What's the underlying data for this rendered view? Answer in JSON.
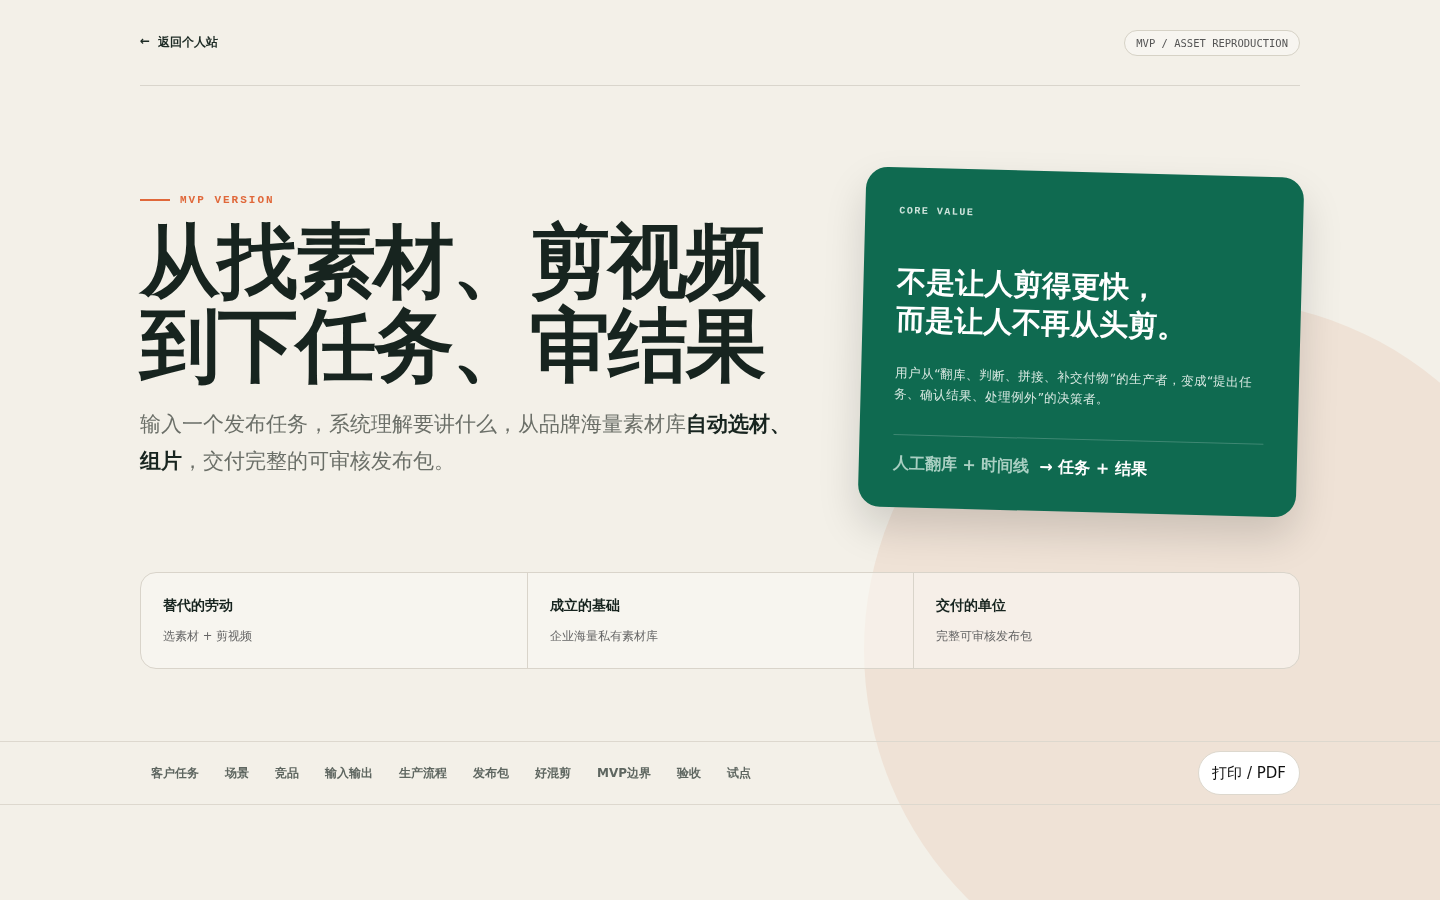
{
  "header": {
    "back_link": {
      "arrow": "←",
      "label": "返回个人站"
    },
    "badge": "MVP / ASSET REPRODUCTION"
  },
  "hero": {
    "eyebrow": "MVP VERSION",
    "title_lines": [
      "从找素材、剪视频",
      "到下任务、审结果"
    ],
    "subtitle": "输入一个发布任务，系统理解要讲什么，从品牌海量素材库**自动选材、组片**，交付完整的可审核发布包。"
  },
  "card": {
    "eyebrow": "CORE VALUE",
    "headline_lines": [
      "不是让人剪得更快，",
      "而是让人不再从头剪。"
    ],
    "body": "用户从“翻库、判断、拼接、补交付物”的生产者，变成“提出任务、确认结果、处理例外”的决策者。",
    "from": "人工翻库 + 时间线",
    "arrow": "→",
    "to": "任务 + 结果"
  },
  "stats": [
    {
      "title": "替代的劳动",
      "value": "选素材 + 剪视频"
    },
    {
      "title": "成立的基础",
      "value": "企业海量私有素材库"
    },
    {
      "title": "交付的单位",
      "value": "完整可审核发布包"
    }
  ],
  "nav": {
    "items": [
      "客户任务",
      "场景",
      "竞品",
      "输入输出",
      "生产流程",
      "发布包",
      "好混剪",
      "MVP边界",
      "验收",
      "试点"
    ],
    "print_button": "打印 / PDF"
  }
}
